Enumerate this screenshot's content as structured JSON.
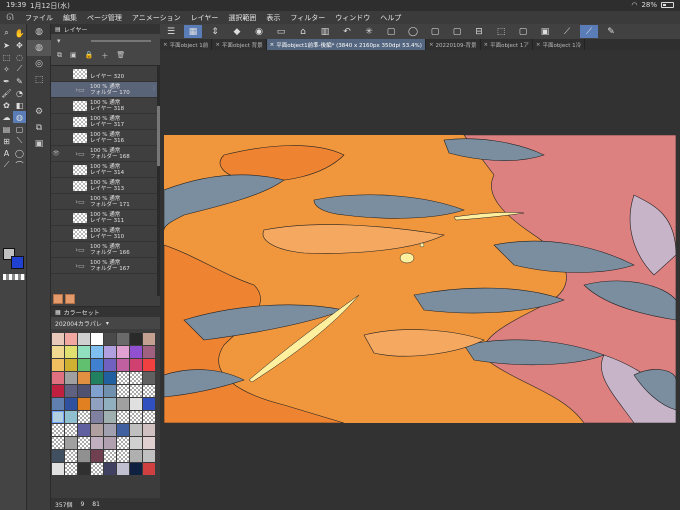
{
  "status": {
    "time": "19:39",
    "date": "1月12日(水)",
    "battery": "28%"
  },
  "menu": [
    "ファイル",
    "編集",
    "ページ管理",
    "アニメーション",
    "レイヤー",
    "選択範囲",
    "表示",
    "フィルター",
    "ウィンドウ",
    "ヘルプ"
  ],
  "layer_panel": {
    "title": "レイヤー",
    "layers": [
      {
        "line1": "",
        "line2": "レイヤー 320",
        "type": "raster"
      },
      {
        "line1": "100 % 通常",
        "line2": "フォルダー 170",
        "type": "folder",
        "selected": true
      },
      {
        "line1": "100 % 通常",
        "line2": "レイヤー 318",
        "type": "raster"
      },
      {
        "line1": "100 % 通常",
        "line2": "レイヤー 317",
        "type": "raster"
      },
      {
        "line1": "100 % 通常",
        "line2": "レイヤー 316",
        "type": "raster"
      },
      {
        "line1": "100 % 通常",
        "line2": "フォルダー 168",
        "type": "folder"
      },
      {
        "line1": "100 % 通常",
        "line2": "レイヤー 314",
        "type": "raster"
      },
      {
        "line1": "100 % 通常",
        "line2": "レイヤー 313",
        "type": "raster"
      },
      {
        "line1": "100 % 通常",
        "line2": "フォルダー 171",
        "type": "folder"
      },
      {
        "line1": "100 % 通常",
        "line2": "レイヤー 311",
        "type": "raster"
      },
      {
        "line1": "100 % 通常",
        "line2": "レイヤー 310",
        "type": "raster"
      },
      {
        "line1": "100 % 通常",
        "line2": "フォルダー 166",
        "type": "folder"
      },
      {
        "line1": "100 % 通常",
        "line2": "フォルダー 167",
        "type": "folder"
      }
    ]
  },
  "color_panel": {
    "title": "カラーセット",
    "set_name": "202004カラパレ",
    "footer": {
      "count": "357個",
      "a": "9",
      "b": "81"
    },
    "swatches": [
      "#e8c8b8",
      "#f0a8a0",
      "#d0d0d0",
      "#ffffff",
      "#4a4a4a",
      "#6a6a6a",
      "#2a2a2a",
      "#c4a090",
      "#f0d890",
      "#e0e070",
      "#90e0c0",
      "#80c0f0",
      "#b0a0e0",
      "#e0a0d0",
      "#9050d0",
      "#a06080",
      "#f0c060",
      "#d0b030",
      "#60c070",
      "#4080d0",
      "#7060c0",
      "#c060a0",
      "#d04070",
      "#f04040",
      "#e07080",
      "#a0a0a0",
      "#e09040",
      "#208060",
      "#2060a0",
      "trans",
      "trans",
      "#606060",
      "#c02040",
      "#606080",
      "#505070",
      "#80a0d0",
      "#7090b0",
      "trans",
      "trans",
      "trans",
      "#6080b0",
      "#3050a0",
      "#e08020",
      "#90a0c0",
      "#90b0c0",
      "#a0a0a0",
      "#e0e0e0",
      "#3050c0",
      "#b0d0e0",
      "#90c0d0",
      "trans",
      "#8080a0",
      "#a0b0b0",
      "trans",
      "trans",
      "trans",
      "trans",
      "trans",
      "#6060a0",
      "#b0a0a0",
      "#a0a0b0",
      "#4060a0",
      "#c0c0c0",
      "#d0c0c0",
      "trans",
      "#a0a0a0",
      "trans",
      "#c0b0c0",
      "#b0a0b0",
      "trans",
      "#d0d0d0",
      "#e0d0d0",
      "#405060",
      "trans",
      "#909090",
      "#704050",
      "trans",
      "trans",
      "#b0b0b0",
      "#c0c0c0",
      "#e0e0e0",
      "trans",
      "#303030",
      "trans",
      "#404060",
      "#c0c0d0",
      "#102040",
      "#d04040"
    ]
  },
  "tabs": [
    {
      "label": "平面object 1前",
      "active": false
    },
    {
      "label": "平面object 背景",
      "active": false
    },
    {
      "label": "平面object1前準-後編* (3840 x 2160px 350dpi 53.4%)",
      "active": true
    },
    {
      "label": "20220109-背景",
      "active": false
    },
    {
      "label": "平面object 1ア",
      "active": false
    },
    {
      "label": "平面object 1冷",
      "active": false
    }
  ],
  "colors": {
    "accent": "#5a7db8",
    "sky_orange": "#f0963c",
    "deep_orange": "#ee8332",
    "blue_gray": "#7a8ea0",
    "pink": "#dc8080",
    "lavender": "#c8b4c8",
    "light_yellow": "#fff0a0"
  }
}
